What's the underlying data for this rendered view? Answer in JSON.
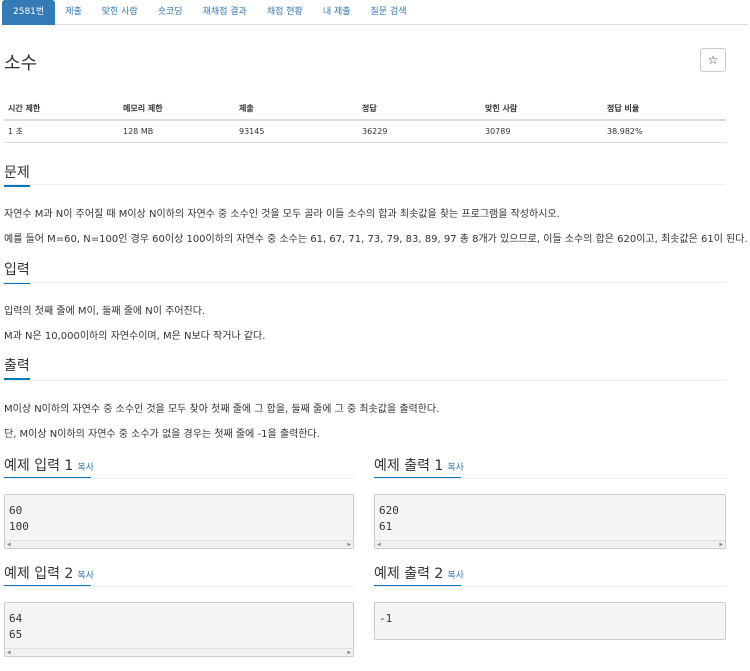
{
  "tabs": [
    {
      "label": "2581번",
      "active": true
    },
    {
      "label": "제출"
    },
    {
      "label": "맞힌 사람"
    },
    {
      "label": "숏코딩"
    },
    {
      "label": "재채점 결과"
    },
    {
      "label": "채점 현황"
    },
    {
      "label": "내 제출"
    },
    {
      "label": "질문 검색"
    }
  ],
  "problem": {
    "title": "소수",
    "star_icon": "☆"
  },
  "info_table": {
    "headers": [
      "시간 제한",
      "메모리 제한",
      "제출",
      "정답",
      "맞힌 사람",
      "정답 비율"
    ],
    "values": [
      "1 초",
      "128 MB",
      "93145",
      "36229",
      "30789",
      "38.982%"
    ]
  },
  "sections": {
    "problem_head": "문제",
    "problem_p1": "자연수 M과 N이 주어질 때 M이상 N이하의 자연수 중 소수인 것을 모두 골라 이들 소수의 합과 최솟값을 찾는 프로그램을 작성하시오.",
    "problem_p2": "예를 들어 M=60, N=100인 경우 60이상 100이하의 자연수 중 소수는 61, 67, 71, 73, 79, 83, 89, 97 총 8개가 있으므로, 이들 소수의 합은 620이고, 최솟값은 61이 된다.",
    "input_head": "입력",
    "input_p1": "입력의 첫째 줄에 M이, 둘째 줄에 N이 주어진다.",
    "input_p2": "M과 N은 10,000이하의 자연수이며, M은 N보다 작거나 같다.",
    "output_head": "출력",
    "output_p1": "M이상 N이하의 자연수 중 소수인 것을 모두 찾아 첫째 줄에 그 합을, 둘째 줄에 그 중 최솟값을 출력한다.",
    "output_p2": "단, M이상 N이하의 자연수 중 소수가 없을 경우는 첫째 줄에 -1을 출력한다."
  },
  "samples": {
    "copy_label": "복사",
    "in1_title": "예제 입력 1",
    "in1_lines": [
      "60",
      "100"
    ],
    "out1_title": "예제 출력 1",
    "out1_lines": [
      "620",
      "61"
    ],
    "in2_title": "예제 입력 2",
    "in2_lines": [
      "64",
      "65"
    ],
    "out2_title": "예제 출력 2",
    "out2_lines": [
      "-1"
    ]
  },
  "colors": {
    "accent": "#337ab7",
    "underline": "#0076c0"
  }
}
